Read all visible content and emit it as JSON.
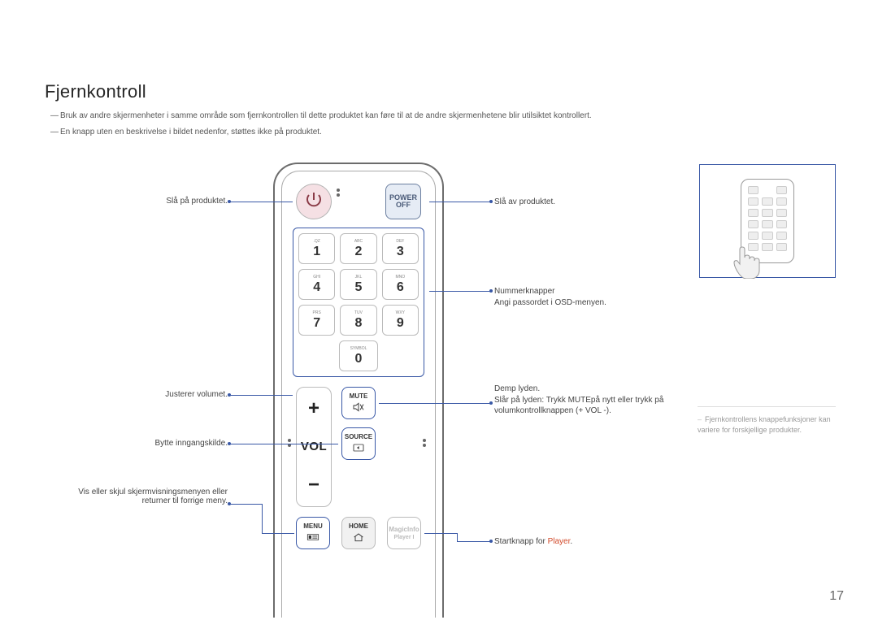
{
  "title": "Fjernkontroll",
  "notes": {
    "n1": "Bruk av andre skjermenheter i samme område som fjernkontrollen til dette produktet kan føre til at de andre skjermenhetene blir utilsiktet kontrollert.",
    "n2": "En knapp uten en beskrivelse i bildet nedenfor, støttes ikke på produktet."
  },
  "remote": {
    "power_off_1": "POWER",
    "power_off_2": "OFF",
    "vol_label": "VOL",
    "buttons": {
      "mute": "MUTE",
      "source": "SOURCE",
      "menu": "MENU",
      "home": "HOME",
      "magic1": "MagicInfo",
      "magic2": "Player I"
    },
    "keys": {
      "k1": "1",
      "k1t": ".QZ",
      "k2": "2",
      "k2t": "ABC",
      "k3": "3",
      "k3t": "DEF",
      "k4": "4",
      "k4t": "GHI",
      "k5": "5",
      "k5t": "JKL",
      "k6": "6",
      "k6t": "MNO",
      "k7": "7",
      "k7t": "PRS",
      "k8": "8",
      "k8t": "TUV",
      "k9": "9",
      "k9t": "WXY",
      "k0": "0",
      "k0t": "SYMBOL"
    }
  },
  "labels": {
    "left": {
      "power_on": "Slå på produktet.",
      "volume": "Justerer volumet.",
      "source": "Bytte inngangskilde.",
      "menu": "Vis eller skjul skjermvisningsmenyen eller returner til forrige meny."
    },
    "right": {
      "power_off": "Slå av produktet.",
      "numpad_1": "Nummerknapper",
      "numpad_2": "Angi passordet i OSD-menyen.",
      "mute_1": "Demp lyden.",
      "mute_2": "Slår på lyden: Trykk MUTEpå nytt eller trykk på volumkontrollknappen (+ VOL -).",
      "player_pre": "Startknapp for ",
      "player_red": "Player",
      "player_post": "."
    }
  },
  "sidenote": "Fjernkontrollens knappefunksjoner kan variere for forskjellige produkter.",
  "page_number": "17"
}
